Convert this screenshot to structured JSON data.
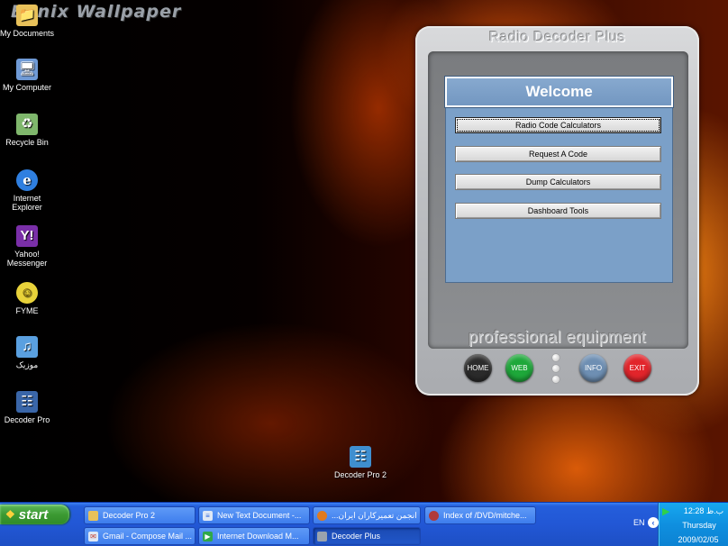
{
  "wallpaper": {
    "title": "Bonix Wallpaper"
  },
  "desktop_icons": [
    {
      "label": "My Documents",
      "icon": "folder-documents-icon",
      "color": "#e8c15a"
    },
    {
      "label": "My Computer",
      "icon": "computer-icon",
      "color": "#6f9ad6"
    },
    {
      "label": "Recycle Bin",
      "icon": "recycle-bin-icon",
      "color": "#7fb76c"
    },
    {
      "label": "Internet Explorer",
      "icon": "internet-explorer-icon",
      "color": "#2f7fe0"
    },
    {
      "label": "Yahoo! Messenger",
      "icon": "yahoo-messenger-icon",
      "color": "#7a2fa8"
    },
    {
      "label": "FYME",
      "icon": "smiley-icon",
      "color": "#e8d23a"
    },
    {
      "label": "موزیک",
      "icon": "music-icon",
      "color": "#5aa0e0"
    },
    {
      "label": "Decoder Pro",
      "icon": "decoder-pro-icon",
      "color": "#3a66a8"
    },
    {
      "label": "Decoder Pro 2",
      "icon": "decoder-pro-2-icon",
      "color": "#3f8fd0"
    }
  ],
  "app": {
    "title": "Radio Decoder Plus",
    "welcome": "Welcome",
    "menu": [
      "Radio Code Calculators",
      "Request A Code",
      "Dump Calculators",
      "Dashboard Tools"
    ],
    "tagline": "professional equipment",
    "buttons": {
      "home": {
        "label": "HOME",
        "color": "#2b2b2b"
      },
      "web": {
        "label": "WEB",
        "color": "#1ea83a"
      },
      "info": {
        "label": "INFO",
        "color": "#6e8fb3"
      },
      "exit": {
        "label": "EXIT",
        "color": "#e2252b"
      }
    }
  },
  "taskbar": {
    "start_label": "start",
    "tasks": [
      {
        "label": "Decoder Pro 2",
        "icon": "folder-icon",
        "active": false
      },
      {
        "label": "New Text Document -...",
        "icon": "notepad-icon",
        "active": false
      },
      {
        "label": "...انجمن تعمیرکاران ایران",
        "icon": "firefox-icon",
        "active": false
      },
      {
        "label": "Index of /DVD/mitche...",
        "icon": "browser-icon",
        "active": false
      },
      {
        "label": "Gmail - Compose Mail ...",
        "icon": "gmail-icon",
        "active": false
      },
      {
        "label": "Internet Download M...",
        "icon": "download-manager-icon",
        "active": false
      },
      {
        "label": "Decoder Plus",
        "icon": "decoder-plus-icon",
        "active": true
      }
    ],
    "tray": {
      "lang": "EN",
      "time": "12:28 ب.ظ",
      "day": "Thursday",
      "date": "2009/02/05"
    }
  }
}
